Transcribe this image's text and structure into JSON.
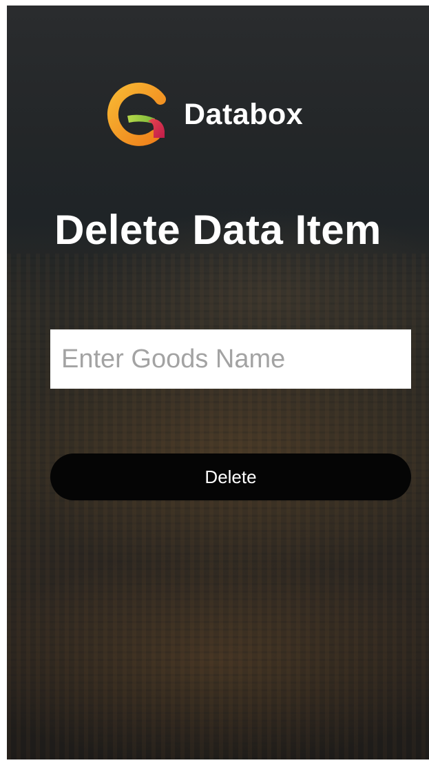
{
  "app": {
    "brand_name": "Databox",
    "logo_icon": "databox-logo-icon"
  },
  "page": {
    "title": "Delete Data Item"
  },
  "form": {
    "goods_name_value": "",
    "goods_name_placeholder": "Enter Goods Name",
    "delete_label": "Delete"
  },
  "colors": {
    "logo_orange": "#f39c1f",
    "logo_green": "#9bc93c",
    "logo_red": "#d9254d",
    "button_bg": "#050505",
    "placeholder": "#a3a3a3"
  }
}
